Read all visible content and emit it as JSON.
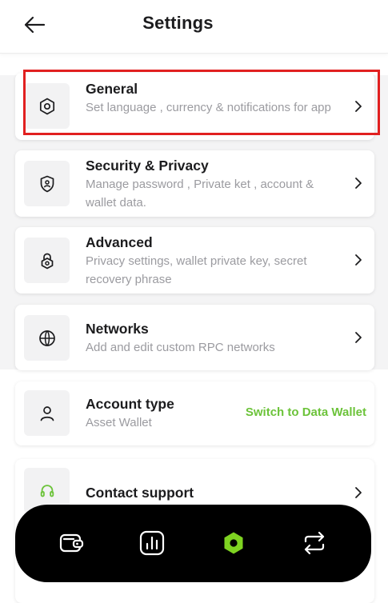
{
  "header": {
    "title": "Settings"
  },
  "settings": [
    {
      "title": "General",
      "description": "Set language , currency & notifications for app",
      "icon": "hexagon-settings-icon"
    },
    {
      "title": "Security & Privacy",
      "description": "Manage password , Private ket , account & wallet data.",
      "icon": "shield-user-icon"
    },
    {
      "title": "Advanced",
      "description": "Privacy settings, wallet private key, secret recovery phrase",
      "icon": "lock-gear-icon"
    },
    {
      "title": "Networks",
      "description": "Add and edit custom RPC networks",
      "icon": "globe-icon"
    }
  ],
  "account": {
    "title": "Account type",
    "value": "Asset Wallet",
    "action": "Switch to Data Wallet",
    "icon": "user-icon"
  },
  "support": {
    "title": "Contact support",
    "icon": "headset-icon"
  },
  "nav": [
    {
      "name": "wallet",
      "icon": "wallet-icon",
      "active": false
    },
    {
      "name": "stats",
      "icon": "chart-icon",
      "active": false
    },
    {
      "name": "settings",
      "icon": "hexagon-settings-icon",
      "active": true
    },
    {
      "name": "swap",
      "icon": "swap-icon",
      "active": false
    }
  ],
  "colors": {
    "accent": "#6cc33a",
    "highlight": "#e12020",
    "nav_bg": "#000000"
  }
}
